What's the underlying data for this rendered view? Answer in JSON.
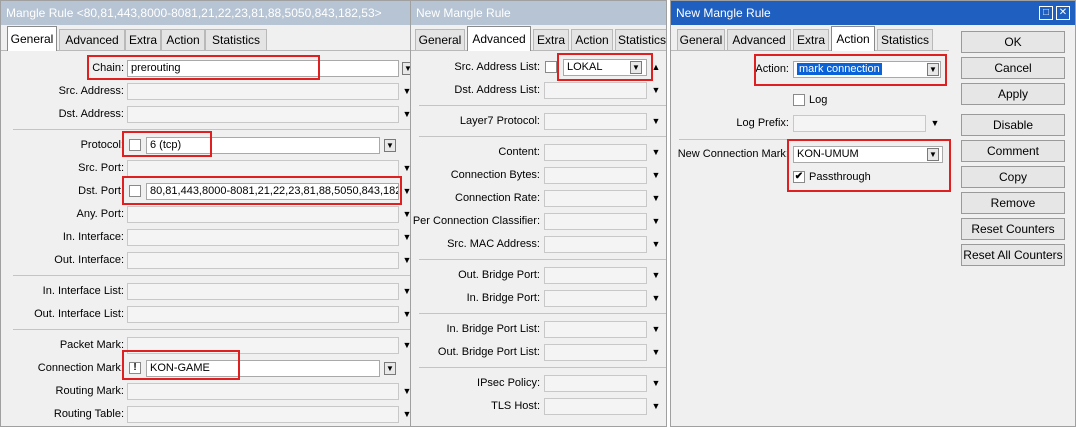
{
  "win1": {
    "title": "Mangle Rule <80,81,443,8000-8081,21,22,23,81,88,5050,843,182,53>",
    "tabs": [
      "General",
      "Advanced",
      "Extra",
      "Action",
      "Statistics"
    ],
    "chain_label": "Chain:",
    "chain_value": "prerouting",
    "src_address_label": "Src. Address:",
    "dst_address_label": "Dst. Address:",
    "protocol_label": "Protocol:",
    "protocol_value": "6 (tcp)",
    "src_port_label": "Src. Port:",
    "dst_port_label": "Dst. Port:",
    "dst_port_value": "80,81,443,8000-8081,21,22,23,81,88,5050,843,182",
    "any_port_label": "Any. Port:",
    "in_interface_label": "In. Interface:",
    "out_interface_label": "Out. Interface:",
    "in_interface_list_label": "In. Interface List:",
    "out_interface_list_label": "Out. Interface List:",
    "packet_mark_label": "Packet Mark:",
    "connection_mark_label": "Connection Mark:",
    "connection_mark_negate": "!",
    "connection_mark_value": "KON-GAME",
    "routing_mark_label": "Routing Mark:",
    "routing_table_label": "Routing Table:"
  },
  "win2": {
    "title": "New Mangle Rule",
    "tabs": [
      "General",
      "Advanced",
      "Extra",
      "Action",
      "Statistics"
    ],
    "src_address_list_label": "Src. Address List:",
    "src_address_list_value": "LOKAL",
    "dst_address_list_label": "Dst. Address List:",
    "layer7_label": "Layer7 Protocol:",
    "content_label": "Content:",
    "connection_bytes_label": "Connection Bytes:",
    "connection_rate_label": "Connection Rate:",
    "per_conn_classifier_label": "Per Connection Classifier:",
    "src_mac_label": "Src. MAC Address:",
    "out_bridge_port_label": "Out. Bridge Port:",
    "in_bridge_port_label": "In. Bridge Port:",
    "in_bridge_port_list_label": "In. Bridge Port List:",
    "out_bridge_port_list_label": "Out. Bridge Port List:",
    "ipsec_policy_label": "IPsec Policy:",
    "tls_host_label": "TLS Host:"
  },
  "win3": {
    "title": "New Mangle Rule",
    "tabs": [
      "General",
      "Advanced",
      "Extra",
      "Action",
      "Statistics"
    ],
    "action_label": "Action:",
    "action_value": "mark connection",
    "log_label": "Log",
    "log_prefix_label": "Log Prefix:",
    "new_conn_mark_label": "New Connection Mark:",
    "new_conn_mark_value": "KON-UMUM",
    "passthrough_label": "Passthrough",
    "passthrough_check": "✔",
    "buttons": [
      "OK",
      "Cancel",
      "Apply",
      "Disable",
      "Comment",
      "Copy",
      "Remove",
      "Reset Counters",
      "Reset All Counters"
    ]
  }
}
